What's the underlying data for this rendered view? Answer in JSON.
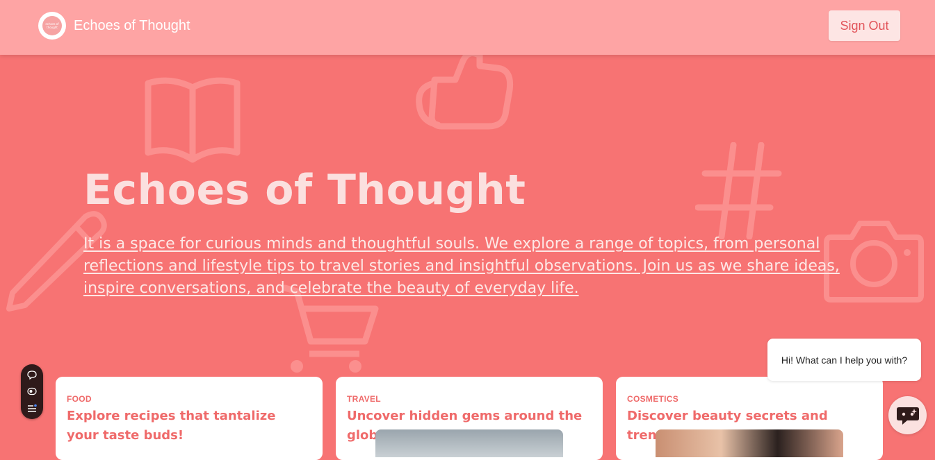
{
  "header": {
    "logo_text": "echoes of thought",
    "brand_name": "Echoes of Thought",
    "signout_label": "Sign Out"
  },
  "hero": {
    "title": "Echoes of Thought",
    "description": "It is a space for curious minds and thoughtful souls. We explore a range of topics, from personal reflections and lifestyle tips to travel stories and insightful observations. Join us as we share ideas, inspire conversations, and celebrate the beauty of everyday life."
  },
  "background_icons": [
    "book-icon",
    "thumbs-up-icon",
    "hashtag-icon",
    "pencil-icon",
    "shopping-cart-icon",
    "camera-icon"
  ],
  "cards": [
    {
      "category": "FOOD",
      "title": "Explore recipes that tantalize your taste buds!"
    },
    {
      "category": "TRAVEL",
      "title": "Uncover hidden gems around the globe!"
    },
    {
      "category": "COSMETICS",
      "title": "Discover beauty secrets and trends!"
    }
  ],
  "toolbar": {
    "icons": [
      "comment-icon",
      "toggle-icon",
      "menu-icon"
    ]
  },
  "chat": {
    "bubble_text": "Hi! What can I help you with?",
    "launcher_icon": "chat-bot-icon"
  },
  "colors": {
    "background": "#f77373",
    "header": "#fea4a4",
    "accent": "#ef6a6a",
    "button_bg": "#fde5e4",
    "toolbar": "#2f1a1a"
  }
}
